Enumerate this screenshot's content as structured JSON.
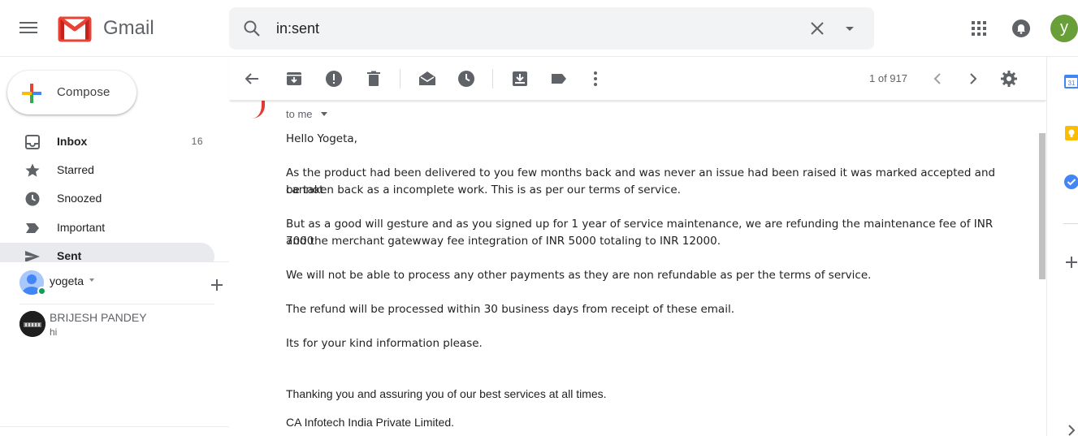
{
  "header": {
    "app_name": "Gmail",
    "search_value": "in:sent",
    "account_initial": "y"
  },
  "nav": {
    "compose_label": "Compose",
    "items": [
      {
        "label": "Inbox",
        "count": "16"
      },
      {
        "label": "Starred",
        "count": ""
      },
      {
        "label": "Snoozed",
        "count": ""
      },
      {
        "label": "Important",
        "count": ""
      },
      {
        "label": "Sent",
        "count": ""
      }
    ]
  },
  "hangouts": {
    "user_name": "yogeta",
    "contact_name": "BRIJESH PANDEY",
    "contact_message": "hi"
  },
  "toolbar": {
    "pager": "1 of 917"
  },
  "message": {
    "recipient": "to me",
    "greeting": "Hello Yogeta,",
    "para1_line1": "As the product had been delivered to you few months back and was never an issue had been raised it was marked accepted and cannot",
    "para1_line2": "be taken back as a incomplete work. This is as per our terms of service.",
    "para2_line1": "But as a good will gesture and as you signed up for 1 year of service maintenance, we are refunding the maintenance fee of INR 7000",
    "para2_line2": "and the merchant gatewway fee integration of INR 5000 totaling to INR 12000.",
    "para3": "We will not be able to process any other payments as they are non refundable as per the terms of service.",
    "para4": "The refund will be processed within 30 business days from receipt of these email.",
    "para5": "Its for your kind information please.",
    "closing": "Thanking you and assuring you of our best services at all times.",
    "company": "CA Infotech India Private Limited."
  },
  "colors": {
    "gmail_red": "#EA4335",
    "avatar_green": "#689f38",
    "active_nav_bg": "#e8eaed"
  },
  "icons": [
    "menu-icon",
    "gmail-logo",
    "search-icon",
    "clear-icon",
    "search-options-icon",
    "apps-icon",
    "notifications-icon",
    "back-icon",
    "archive-icon",
    "report-spam-icon",
    "delete-icon",
    "mark-unread-icon",
    "snooze-icon",
    "move-to-icon",
    "labels-icon",
    "more-icon",
    "prev-icon",
    "next-icon",
    "settings-icon",
    "inbox-icon",
    "star-icon",
    "clock-icon",
    "important-icon",
    "send-icon",
    "calendar-icon",
    "keep-icon",
    "tasks-icon",
    "add-addon-icon"
  ]
}
